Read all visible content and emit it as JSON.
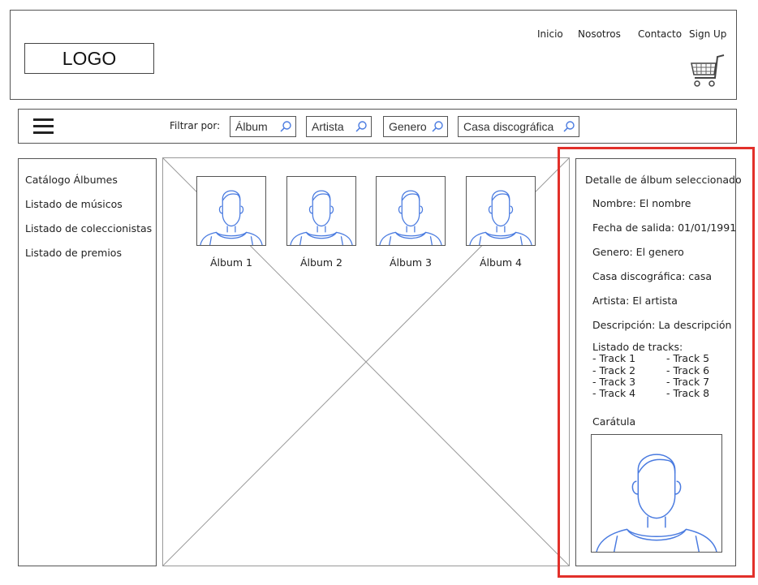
{
  "header": {
    "logo": "LOGO",
    "nav": [
      "Inicio",
      "Nosotros",
      "Contacto",
      "Sign Up"
    ],
    "cart_icon": "cart-icon"
  },
  "filter": {
    "menu_icon": "hamburger-icon",
    "label": "Filtrar por:",
    "fields": [
      "Álbum",
      "Artista",
      "Genero",
      "Casa discográfica"
    ],
    "search_icon": "search-icon"
  },
  "sidebar": {
    "items": [
      "Catálogo Álbumes",
      "Listado de músicos",
      "Listado de coleccionistas",
      "Listado de premios"
    ]
  },
  "albums": [
    {
      "label": "Álbum 1"
    },
    {
      "label": "Álbum 2"
    },
    {
      "label": "Álbum 3"
    },
    {
      "label": "Álbum 4"
    }
  ],
  "detail": {
    "title": "Detalle de álbum seleccionado",
    "nombre": "Nombre: El nombre",
    "fecha": "Fecha de salida: 01/01/1991",
    "genero": "Genero: El genero",
    "casa": "Casa discográfica: casa",
    "artista": "Artista: El artista",
    "descripcion": "Descripción: La descripción",
    "tracks_title": "Listado de tracks:",
    "tracks_left": [
      "- Track 1",
      "- Track 2",
      "- Track 3",
      "- Track 4"
    ],
    "tracks_right": [
      "- Track 5",
      "- Track 6",
      "- Track 7",
      "- Track 8"
    ],
    "cover_label": "Carátula"
  },
  "colors": {
    "highlight": "#e2302a",
    "avatar_stroke": "#4a7be0"
  }
}
